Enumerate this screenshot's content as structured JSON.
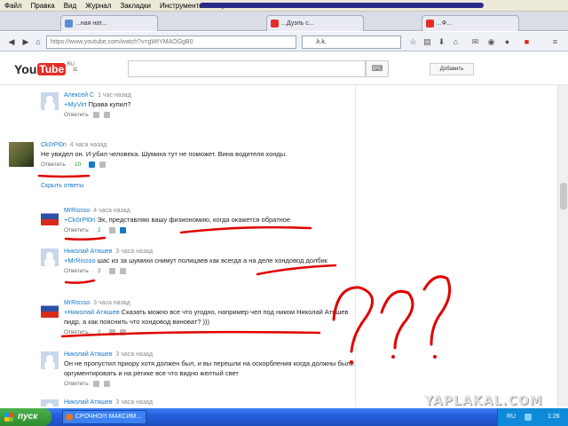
{
  "menubar": {
    "items": [
      "Файл",
      "Правка",
      "Вид",
      "Журнал",
      "Закладки",
      "Инструменты",
      "Справка"
    ]
  },
  "tabs": [
    {
      "label": "...ная нат..."
    },
    {
      "label": "...Дуэль с..."
    },
    {
      "label": "...Ф..."
    }
  ],
  "navbar": {
    "url": "https://www.youtube.com/watch?v=gWtYMAOGgB0",
    "search_value": ".k.k."
  },
  "youtube": {
    "logo_you": "You",
    "logo_tube": "Tube",
    "logo_region": "RU",
    "add_video_label": "Добавить"
  },
  "comments": [
    {
      "author": "Алексей С",
      "time": "1 час назад",
      "mention": "+MyVirt",
      "text": " Права купил?",
      "reply_label": "Ответить",
      "likes": ""
    },
    {
      "author": "Ck0rPl0n",
      "time": "4 часа назад",
      "mention": "",
      "text": "Не увидел он. И убил человека. Шумиха тут не поможет. Вина водителя хонды.",
      "reply_label": "Ответить",
      "likes": "10"
    },
    {
      "author": "MrRissso",
      "time": "4 часа назад",
      "mention": "+Ck0rPl0n",
      "text": " Эх, представляю вашу физиономию, когда окажется обратное",
      "reply_label": "Ответить",
      "likes": "2"
    },
    {
      "author": "Николай Атяшев",
      "time": "3 часа назад",
      "mention": "+MrRissso",
      "text": " шас из за шумихи снимут полицаев как всегда а на деле хондовод долбик",
      "reply_label": "Ответить",
      "likes": "2"
    },
    {
      "author": "MrRissso",
      "time": "3 часа назад",
      "mention": "+Николай Атяшев",
      "text": " Сказать можно все что угодно, например чел под ником Николай Атяшев пидр, а как пояснить что хондовод виноват? )))",
      "reply_label": "Ответить",
      "likes": "2"
    },
    {
      "author": "Николай Атяшев",
      "time": "3 часа назад",
      "mention": "",
      "text": "Он не пропустил приору хотя должен был, и вы перешли на оскорбления когда должны были оргументировать и на регике все что видно желтый свет",
      "reply_label": "Ответить",
      "likes": ""
    },
    {
      "author": "Николай Атяшев",
      "time": "3 часа назад",
      "mention": "",
      "text": "",
      "reply_label": "",
      "likes": ""
    }
  ],
  "hide_replies_label": "Скрыть ответы",
  "watermark": "YAPLAKAL.COM",
  "taskbar": {
    "start_label": "пуск",
    "task_label": "СРОЧНО!!! МАКСИМ...",
    "lang": "RU",
    "clock": "1:26"
  },
  "colors": {
    "accent": "#167ac6",
    "annotation_red": "#e10000",
    "youtube_red": "#e52d27"
  }
}
